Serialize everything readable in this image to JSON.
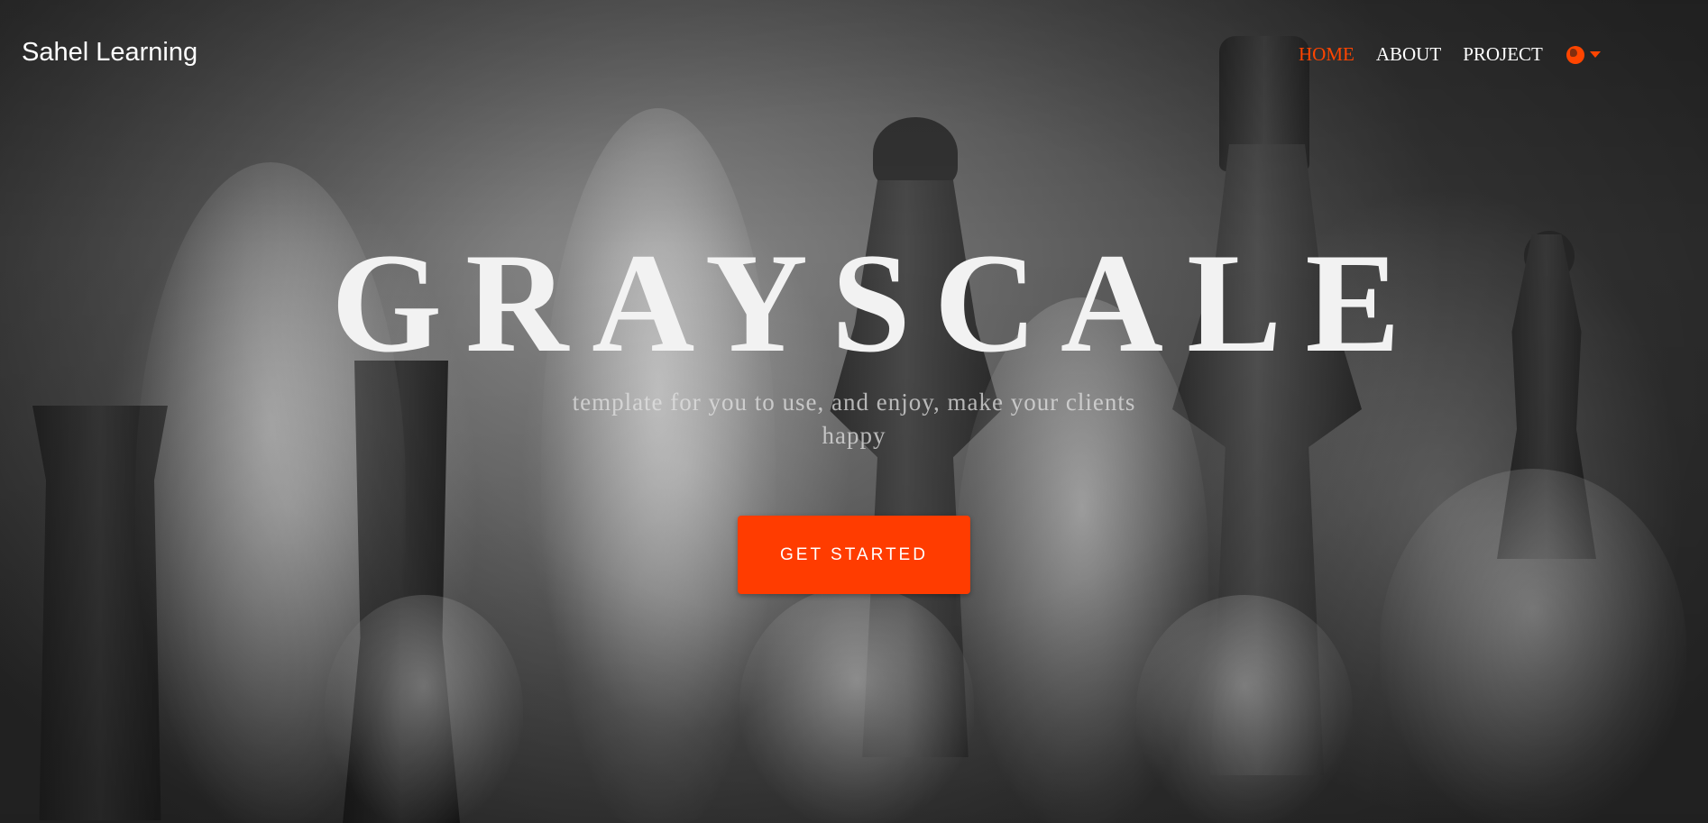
{
  "brand": {
    "name": "Sahel Learning"
  },
  "nav": {
    "items": [
      {
        "label": "HOME",
        "active": true
      },
      {
        "label": "ABOUT",
        "active": false
      },
      {
        "label": "PROJECT",
        "active": false
      }
    ],
    "language_icon": "globe-icon",
    "dropdown_icon": "caret-down-icon"
  },
  "hero": {
    "title": "GRAYSCALE",
    "subtitle": "template for you to use, and enjoy, make your clients happy",
    "cta_label": "GET STARTED"
  },
  "colors": {
    "accent": "#ff4500",
    "button": "#ff3c00",
    "text": "#ffffff"
  }
}
